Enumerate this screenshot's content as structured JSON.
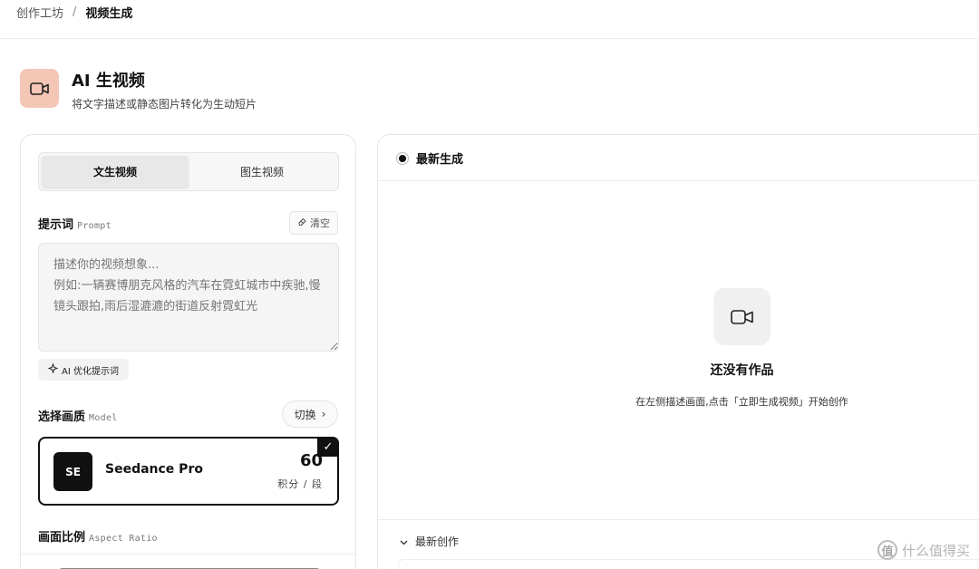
{
  "breadcrumb": {
    "parent": "创作工坊",
    "separator": "/",
    "current": "视频生成"
  },
  "header": {
    "title": "AI 生视频",
    "subtitle": "将文字描述或静态图片转化为生动短片",
    "icon": "video-camera-icon"
  },
  "tabs": [
    {
      "label": "文生视频",
      "active": true
    },
    {
      "label": "图生视频",
      "active": false
    }
  ],
  "prompt": {
    "label": "提示词",
    "label_en": "Prompt",
    "clear_label": "清空",
    "placeholder": "描述你的视频想象...\n例如:一辆赛博朋克风格的汽车在霓虹城市中疾驰,慢镜头跟拍,雨后湿漉漉的街道反射霓虹光",
    "optimize_label": "AI 优化提示词"
  },
  "model": {
    "label": "选择画质",
    "label_en": "Model",
    "switch_label": "切换",
    "switch_chevron": "›",
    "avatar": "SE",
    "name": "Seedance Pro",
    "credits": "60",
    "unit": "积分 / 段",
    "check": "✓",
    "selected": true
  },
  "aspect": {
    "label": "画面比例",
    "label_en": "Aspect Ratio"
  },
  "right": {
    "latest_label": "最新生成",
    "empty_title": "还没有作品",
    "empty_desc": "在左侧描述画面,点击「立即生成视频」开始创作",
    "recent_label": "最新创作",
    "recent_chevron": "⌄"
  },
  "watermark": {
    "logo": "值",
    "text": "什么值得买"
  }
}
